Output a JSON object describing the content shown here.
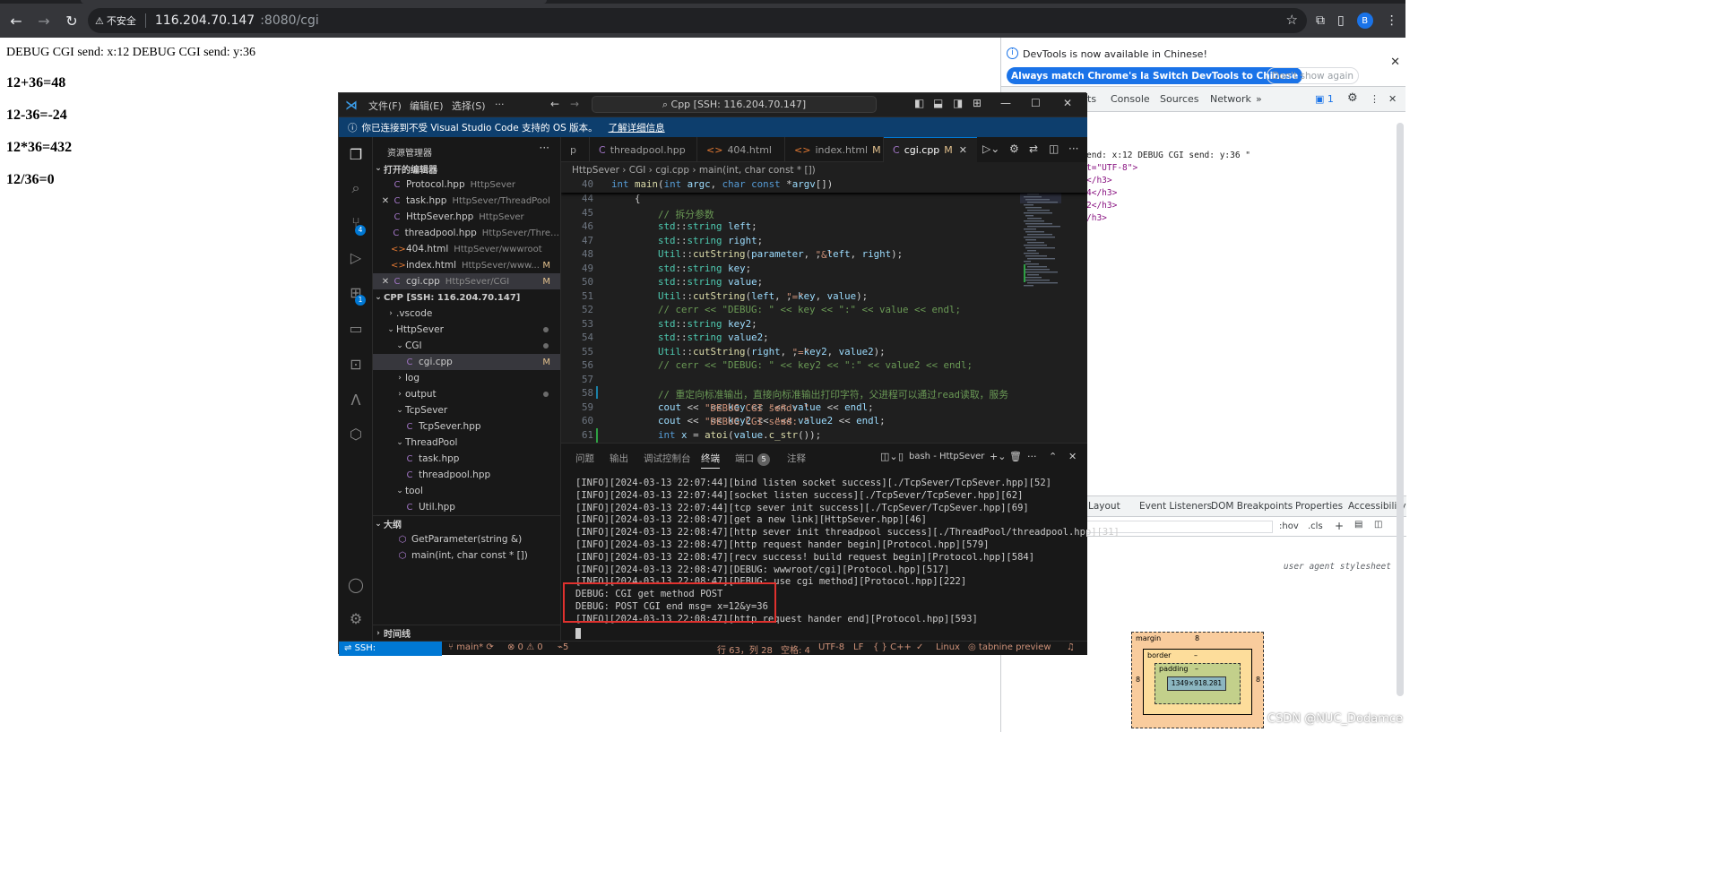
{
  "browser": {
    "security_label": "不安全",
    "url_host": "116.204.70.147",
    "url_path": ":8080/cgi",
    "avatar": "B"
  },
  "page": {
    "debug_line": "DEBUG CGI send: x:12 DEBUG CGI send: y:36",
    "results": [
      "12+36=48",
      "12-36=-24",
      "12*36=432",
      "12/36=0"
    ]
  },
  "devtools": {
    "info_text": "DevTools is now available in Chinese!",
    "btn_match": "Always match Chrome's language",
    "btn_switch": "Switch DevTools to Chinese",
    "btn_dont": "Don't show again",
    "tabs": [
      "ts",
      "Console",
      "Sources",
      "Network"
    ],
    "issues_count": "1",
    "element_lines": [
      "end: x:12 DEBUG CGI send: y:36 \"",
      "t=\"UTF-8\">",
      "</h3>",
      "4</h3>",
      "2</h3>",
      "/h3>"
    ],
    "bottom_tabs": [
      "Layout",
      "Event Listeners",
      "DOM Breakpoints",
      "Properties",
      "Accessibility"
    ],
    "filter_hov": ":hov",
    "filter_cls": ".cls",
    "ua_stylesheet": "user agent stylesheet",
    "box_margin_label": "margin",
    "box_margin_value": "8",
    "box_border_label": "border",
    "box_border_value": "–",
    "box_padding_label": "padding",
    "box_padding_value": "–",
    "box_content": "1349×918.281",
    "box_side_value": "8"
  },
  "watermark": "CSDN @NUC_Dodamce",
  "vscode": {
    "menus": [
      "文件(F)",
      "编辑(E)",
      "选择(S)",
      "···"
    ],
    "command_center": "Cpp [SSH: 116.204.70.147]",
    "banner_text": "你已连接到不受 Visual Studio Code 支持的 OS 版本。",
    "banner_link": "了解详细信息",
    "activity_badges": [
      "4",
      "1"
    ],
    "sidebar_title": "资源管理器",
    "open_editors_header": "打开的编辑器",
    "open_editors": [
      {
        "name": "Protocol.hpp",
        "desc": "HttpSever",
        "icon": "C",
        "mark": "",
        "close": false
      },
      {
        "name": "task.hpp",
        "desc": "HttpSever/ThreadPool",
        "icon": "C",
        "mark": "",
        "close": true
      },
      {
        "name": "HttpSever.hpp",
        "desc": "HttpSever",
        "icon": "C",
        "mark": "",
        "close": false
      },
      {
        "name": "threadpool.hpp",
        "desc": "HttpSever/Threa...",
        "icon": "C",
        "mark": "",
        "close": false
      },
      {
        "name": "404.html",
        "desc": "HttpSever/wwwroot",
        "icon": "<>",
        "mark": "",
        "close": false
      },
      {
        "name": "index.html",
        "desc": "HttpSever/www...",
        "icon": "<>",
        "mark": "M",
        "close": false
      },
      {
        "name": "cgi.cpp",
        "desc": "HttpSever/CGI",
        "icon": "C",
        "mark": "M",
        "close": true
      }
    ],
    "workspace_header": "CPP [SSH: 116.204.70.147]",
    "tree": [
      {
        "name": ".vscode",
        "indent": 0,
        "twisty": "›",
        "icon": "",
        "dot": false,
        "mark": ""
      },
      {
        "name": "HttpSever",
        "indent": 0,
        "twisty": "⌄",
        "icon": "",
        "dot": true,
        "mark": ""
      },
      {
        "name": "CGI",
        "indent": 1,
        "twisty": "⌄",
        "icon": "",
        "dot": true,
        "mark": ""
      },
      {
        "name": "cgi.cpp",
        "indent": 2,
        "twisty": "",
        "icon": "C",
        "dot": false,
        "mark": "M"
      },
      {
        "name": "log",
        "indent": 1,
        "twisty": "›",
        "icon": "",
        "dot": false,
        "mark": ""
      },
      {
        "name": "output",
        "indent": 1,
        "twisty": "›",
        "icon": "",
        "dot": true,
        "mark": ""
      },
      {
        "name": "TcpSever",
        "indent": 1,
        "twisty": "⌄",
        "icon": "",
        "dot": false,
        "mark": ""
      },
      {
        "name": "TcpSever.hpp",
        "indent": 2,
        "twisty": "",
        "icon": "C",
        "dot": false,
        "mark": ""
      },
      {
        "name": "ThreadPool",
        "indent": 1,
        "twisty": "⌄",
        "icon": "",
        "dot": false,
        "mark": ""
      },
      {
        "name": "task.hpp",
        "indent": 2,
        "twisty": "",
        "icon": "C",
        "dot": false,
        "mark": ""
      },
      {
        "name": "threadpool.hpp",
        "indent": 2,
        "twisty": "",
        "icon": "C",
        "dot": false,
        "mark": ""
      },
      {
        "name": "tool",
        "indent": 1,
        "twisty": "⌄",
        "icon": "",
        "dot": false,
        "mark": ""
      },
      {
        "name": "Util.hpp",
        "indent": 2,
        "twisty": "",
        "icon": "C",
        "dot": false,
        "mark": ""
      }
    ],
    "outline_header": "大纲",
    "outline": [
      "GetParameter(string &)",
      "main(int, char const * [])"
    ],
    "timeline_header": "时间线",
    "editor_tabs": [
      {
        "name": "p",
        "mark": "",
        "icon": ""
      },
      {
        "name": "threadpool.hpp",
        "mark": "",
        "icon": "C"
      },
      {
        "name": "404.html",
        "mark": "",
        "icon": "<>"
      },
      {
        "name": "index.html",
        "mark": "M",
        "icon": "<>"
      },
      {
        "name": "cgi.cpp",
        "mark": "M",
        "icon": "C"
      }
    ],
    "breadcrumb": "HttpSever  ›  CGI  ›  cgi.cpp  ›  main(int, char const * [])",
    "sticky_line": {
      "num": "40",
      "text": "int main(int argc, char const *argv[])"
    },
    "code": [
      {
        "num": "44",
        "text": "    {"
      },
      {
        "num": "45",
        "text": "        // 拆分参数"
      },
      {
        "num": "46",
        "text": "        std::string left;"
      },
      {
        "num": "47",
        "text": "        std::string right;"
      },
      {
        "num": "48",
        "text": "        Util::cutString(parameter, \"&\", left, right);"
      },
      {
        "num": "49",
        "text": "        std::string key;"
      },
      {
        "num": "50",
        "text": "        std::string value;"
      },
      {
        "num": "51",
        "text": "        Util::cutString(left, \"=\", key, value);"
      },
      {
        "num": "52",
        "text": "        // cerr << \"DEBUG: \" << key << \":\" << value << endl;"
      },
      {
        "num": "53",
        "text": "        std::string key2;"
      },
      {
        "num": "54",
        "text": "        std::string value2;"
      },
      {
        "num": "55",
        "text": "        Util::cutString(right, \"=\", key2, value2);"
      },
      {
        "num": "56",
        "text": "        // cerr << \"DEBUG: \" << key2 << \":\" << value2 << endl;"
      },
      {
        "num": "57",
        "text": ""
      },
      {
        "num": "58",
        "text": "        // 重定向标准输出，直接向标准输出打印字符，父进程可以通过read读取，服务"
      },
      {
        "num": "59",
        "text": "        cout << \"DEBUG CGI send: \" << key << \":\" << value << endl;"
      },
      {
        "num": "60",
        "text": "        cout << \"DEBUG CGI send: \" << key2 << \":\" << value2 << endl;"
      },
      {
        "num": "61",
        "text": "        int x = atoi(value.c_str());"
      }
    ],
    "panel_tabs": [
      "问题",
      "输出",
      "调试控制台",
      "终端",
      "端口",
      "注释"
    ],
    "ports_count": "5",
    "terminal_name": "bash - HttpSever",
    "terminal_lines": [
      "[INFO][2024-03-13 22:07:44][bind listen socket success][./TcpSever/TcpSever.hpp][52]",
      "[INFO][2024-03-13 22:07:44][socket listen success][./TcpSever/TcpSever.hpp][62]",
      "[INFO][2024-03-13 22:07:44][tcp sever init success][./TcpSever/TcpSever.hpp][69]",
      "[INFO][2024-03-13 22:08:47][get a new link][HttpSever.hpp][46]",
      "[INFO][2024-03-13 22:08:47][http sever init threadpool success][./ThreadPool/threadpool.hpp][31]",
      "[INFO][2024-03-13 22:08:47][http request hander begin][Protocol.hpp][579]",
      "[INFO][2024-03-13 22:08:47][recv success! build request begin][Protocol.hpp][584]",
      "[INFO][2024-03-13 22:08:47][DEBUG: wwwroot/cgi][Protocol.hpp][517]",
      "[INFO][2024-03-13 22:08:47][DEBUG: use cgi method][Protocol.hpp][222]",
      "DEBUG: CGI get method POST",
      "DEBUG: POST CGI end msg= x=12&y=36",
      "[INFO][2024-03-13 22:08:47][http request hander end][Protocol.hpp][593]"
    ],
    "status": {
      "remote": "SSH: 116.204.70.147",
      "branch": "main*",
      "problems": "⊗ 0 ⚠ 0",
      "ports": "5",
      "position": "行 63，列 28",
      "spaces": "空格: 4",
      "encoding": "UTF-8",
      "eol": "LF",
      "lang": "{ } C++",
      "os": "Linux",
      "tabnine": "tabnine preview"
    }
  }
}
